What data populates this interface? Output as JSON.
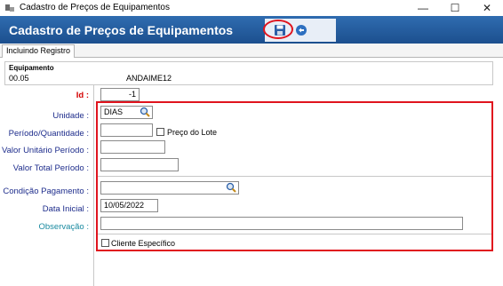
{
  "window": {
    "title": "Cadastro de Preços de Equipamentos",
    "minimize_glyph": "—",
    "maximize_glyph": "☐",
    "close_glyph": "✕"
  },
  "header": {
    "title": "Cadastro de Preços de Equipamentos",
    "icons": [
      "save-icon",
      "undo-icon"
    ]
  },
  "tabs": [
    "Incluindo Registro"
  ],
  "equipment": {
    "label": "Equipamento",
    "code": "00.05",
    "name": "ANDAIME12"
  },
  "form": {
    "id_label": "Id :",
    "id_value": "-1",
    "unidade_label": "Unidade :",
    "unidade_value": "DIAS",
    "periodo_label": "Período/Quantidade :",
    "periodo_value": "",
    "preco_lote_label": "Preço do Lote",
    "preco_lote_checked": false,
    "valor_unitario_label": "Valor Unitário Período :",
    "valor_unitario_value": "",
    "valor_total_label": "Valor Total Período :",
    "valor_total_value": "",
    "condicao_label": "Condição Pagamento :",
    "condicao_value": "",
    "data_inicial_label": "Data Inicial :",
    "data_inicial_value": "10/05/2022",
    "observacao_label": "Observação :",
    "observacao_value": "",
    "cliente_especifico_label": "Cliente Específico",
    "cliente_especifico_checked": false
  },
  "colors": {
    "header_bg": "#1c4f8e",
    "highlight": "#e0141e",
    "label_blue": "#1e2d8c",
    "label_red": "#d40000",
    "label_teal": "#1a8aa0"
  }
}
